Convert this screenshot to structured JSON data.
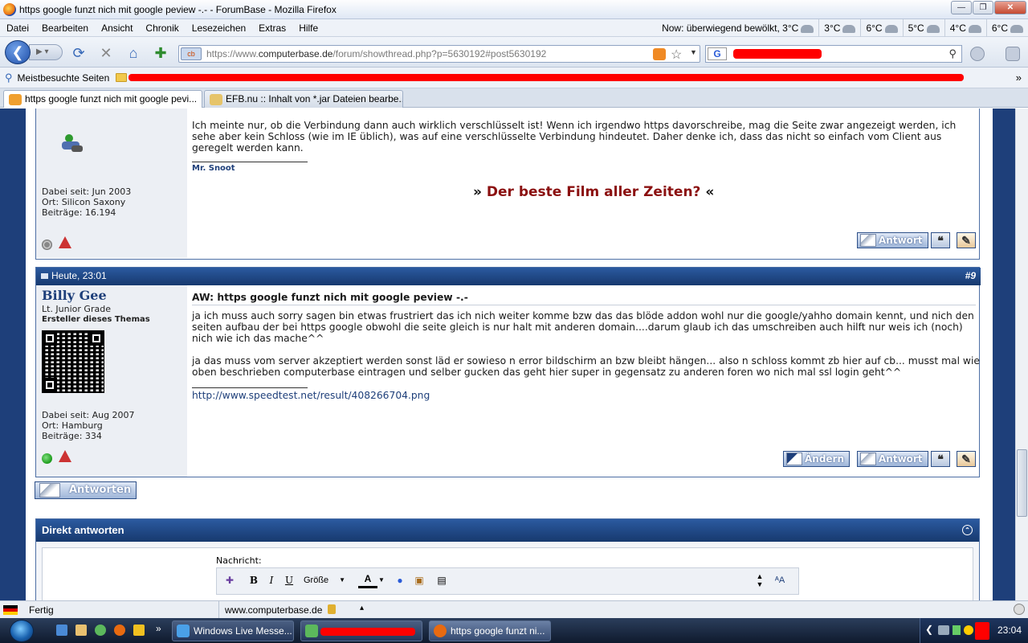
{
  "window": {
    "title": "https google funzt nich mit google peview -.- - ForumBase - Mozilla Firefox"
  },
  "menu": [
    "Datei",
    "Bearbeiten",
    "Ansicht",
    "Chronik",
    "Lesezeichen",
    "Extras",
    "Hilfe"
  ],
  "weather": {
    "now": "Now: überwiegend bewölkt, 3°C",
    "forecast": [
      "3°C",
      "6°C",
      "5°C",
      "4°C",
      "6°C"
    ]
  },
  "nav": {
    "url_prefix": "https://www.",
    "url_domain": "computerbase.de",
    "url_path": "/forum/showthread.php?p=5630192#post5630192"
  },
  "bookmarks": {
    "label": "Meistbesuchte Seiten",
    "more": "»"
  },
  "tabs": [
    {
      "title": "https google funzt nich mit google pevi..."
    },
    {
      "title": "EFB.nu :: Inhalt von *.jar Dateien bearbe..."
    }
  ],
  "post1": {
    "message": "Ich meinte nur, ob die Verbindung dann auch wirklich verschlüsselt ist! Wenn ich irgendwo https davorschreibe, mag die Seite zwar angezeigt werden, ich sehe aber kein Schloss (wie im IE üblich), was auf eine verschlüsselte Verbindung hindeutet. Daher denke ich, dass das nicht so einfach vom Client aus geregelt werden kann.",
    "signature": "Mr. Snoot",
    "link": "Der beste Film aller Zeiten?",
    "user": {
      "since": "Dabei seit: Jun 2003",
      "location": "Ort: Silicon Saxony",
      "posts": "Beiträge: 16.194"
    },
    "reply_button": "Antwort"
  },
  "post2": {
    "date": "Heute, 23:01",
    "number": "#9",
    "username": "Billy Gee",
    "rank": "Lt. Junior Grade",
    "role": "Ersteller dieses Themas",
    "title": "AW: https google funzt nich mit google peview -.-",
    "paragraph1": "ja ich muss auch sorry sagen bin etwas frustriert das ich nich weiter komme bzw das das blöde addon wohl nur die google/yahho domain kennt, und nich den seiten aufbau der bei https google obwohl die seite gleich is nur halt mit anderen domain....darum glaub ich das umschreiben auch hilft nur weis ich (noch) nich wie ich das mache^^",
    "paragraph2": "ja das muss vom server akzeptiert werden sonst läd er sowieso n error bildschirm an bzw bleibt hängen... also n schloss kommt zb hier auf cb... musst mal wie oben beschrieben computerbase eintragen und selber gucken das geht hier super in gegensatz zu anderen foren wo nich mal ssl login geht^^",
    "sig_link": "http://www.speedtest.net/result/408266704.png",
    "user": {
      "since": "Dabei seit: Aug 2007",
      "location": "Ort: Hamburg",
      "posts": "Beiträge: 334"
    },
    "edit_button": "Ändern",
    "reply_button": "Antwort"
  },
  "reply_main_button": "Antworten",
  "quick_reply": {
    "title": "Direkt antworten",
    "label": "Nachricht:",
    "size_select": "Größe"
  },
  "status": {
    "text": "Fertig",
    "domain": "www.computerbase.de"
  },
  "taskbar": {
    "items": [
      {
        "title": "Windows Live Messe..."
      },
      {
        "title": ""
      },
      {
        "title": "https google funzt ni..."
      }
    ],
    "clock": "23:04"
  }
}
